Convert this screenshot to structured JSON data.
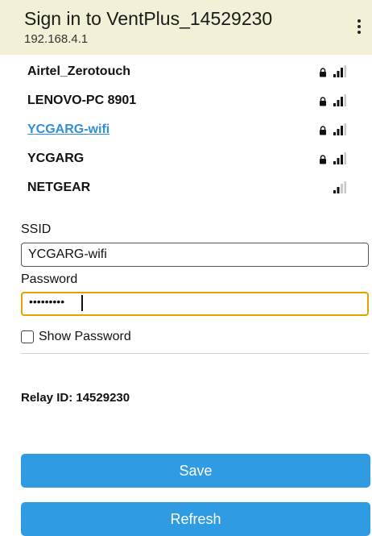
{
  "header": {
    "title": "Sign in to VentPlus_14529230",
    "subtitle": "192.168.4.1",
    "menu_icon": "more-vertical-icon",
    "background": "#f3f0d8"
  },
  "networks": [
    {
      "ssid": "Airtel_Zerotouch",
      "secured": true,
      "selected": false,
      "signal": 3
    },
    {
      "ssid": "LENOVO-PC 8901",
      "secured": true,
      "selected": false,
      "signal": 3
    },
    {
      "ssid": "YCGARG-wifi",
      "secured": true,
      "selected": true,
      "signal": 3
    },
    {
      "ssid": "YCGARG",
      "secured": true,
      "selected": false,
      "signal": 3
    },
    {
      "ssid": "NETGEAR",
      "secured": false,
      "selected": false,
      "signal": 2
    }
  ],
  "form": {
    "ssid_label": "SSID",
    "ssid_value": "YCGARG-wifi",
    "password_label": "Password",
    "password_masked": "•••••••••",
    "show_password_label": "Show Password",
    "show_password_checked": false
  },
  "relay": {
    "text": "Relay ID: 14529230"
  },
  "buttons": {
    "save_label": "Save",
    "refresh_label": "Refresh",
    "color": "#2f9be3"
  },
  "colors": {
    "link": "#2f8fd8",
    "focus_border": "#e0a400"
  }
}
